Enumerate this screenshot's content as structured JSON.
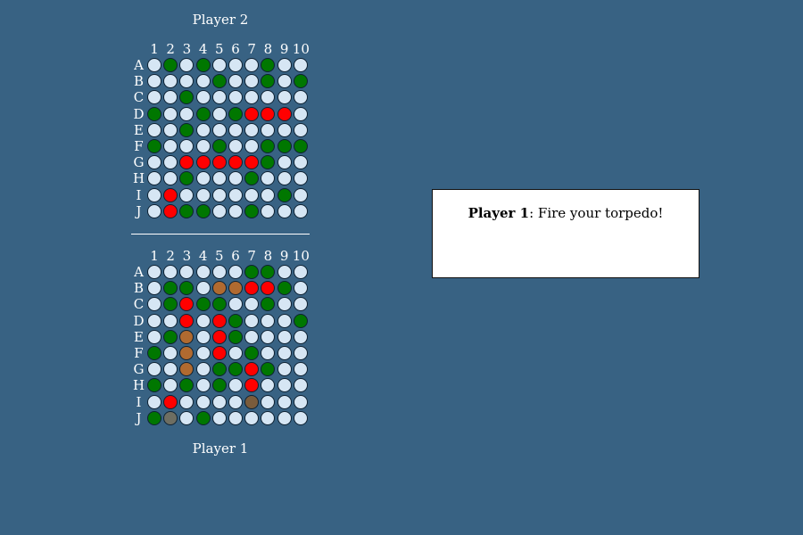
{
  "players": {
    "top_label": "Player 2",
    "bottom_label": "Player 1"
  },
  "message": {
    "player": "Player 1",
    "text": ": Fire your torpedo!"
  },
  "legend_colors": {
    "W": "#d6e6f4",
    "S": "#007700",
    "H": "#ff0000",
    "B": "#b06a30",
    "D": "#7a5c3c",
    "G": "#6e6e62"
  },
  "columns": [
    "1",
    "2",
    "3",
    "4",
    "5",
    "6",
    "7",
    "8",
    "9",
    "10"
  ],
  "rows": [
    "A",
    "B",
    "C",
    "D",
    "E",
    "F",
    "G",
    "H",
    "I",
    "J"
  ],
  "boards": {
    "player2": [
      "WSWSWWWSWW",
      "WWWWSWWSWS",
      "WWSWWWWWWW",
      "SWWSWSHHHW",
      "WWSWWWWWWW",
      "SWWWSWWSSS",
      "WWHHHHHSWW",
      "WWSWWWSWWW",
      "WHWWWWWWSW",
      "WHSSWWSWWW"
    ],
    "player1": [
      "WWWWWWSSWW",
      "WSSWBBHHSW",
      "WSHSSWWSWW",
      "WWHWHSWWWS",
      "WSBWHSWWWW",
      "SWBWHWSWWW",
      "WWBWSSHSWW",
      "SWSWSWHWWW",
      "WHWWWWDWWW",
      "SGWSWWWWWW"
    ]
  }
}
